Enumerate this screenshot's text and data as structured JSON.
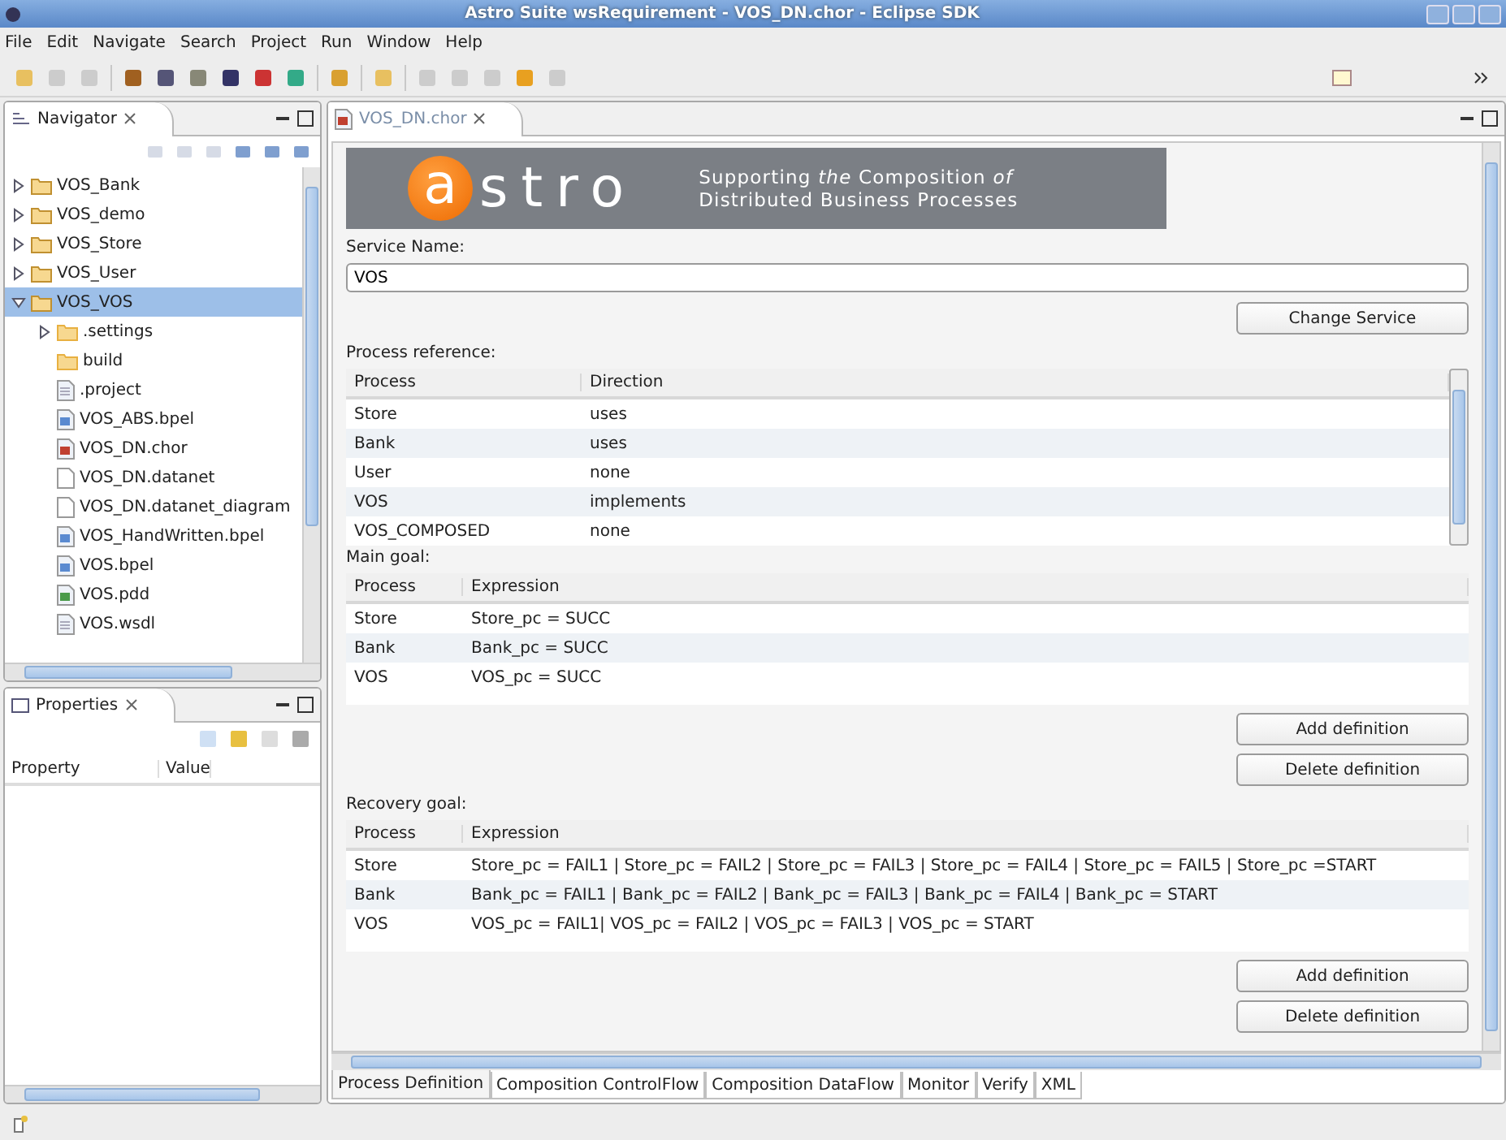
{
  "window": {
    "title": "Astro Suite wsRequirement - VOS_DN.chor - Eclipse SDK"
  },
  "menu": [
    {
      "label": "File"
    },
    {
      "label": "Edit"
    },
    {
      "label": "Navigate"
    },
    {
      "label": "Search"
    },
    {
      "label": "Project"
    },
    {
      "label": "Run"
    },
    {
      "label": "Window"
    },
    {
      "label": "Help"
    }
  ],
  "navigator": {
    "title": "Navigator",
    "items": [
      {
        "label": "VOS_Bank",
        "kind": "project",
        "expanded": false,
        "selected": false
      },
      {
        "label": "VOS_demo",
        "kind": "project",
        "expanded": false,
        "selected": false
      },
      {
        "label": "VOS_Store",
        "kind": "project",
        "expanded": false,
        "selected": false
      },
      {
        "label": "VOS_User",
        "kind": "project",
        "expanded": false,
        "selected": false
      },
      {
        "label": "VOS_VOS",
        "kind": "project",
        "expanded": true,
        "selected": true,
        "children": [
          {
            "label": ".settings",
            "kind": "folder-branch"
          },
          {
            "label": "build",
            "kind": "folder"
          },
          {
            "label": ".project",
            "kind": "file"
          },
          {
            "label": "VOS_ABS.bpel",
            "kind": "bpel"
          },
          {
            "label": "VOS_DN.chor",
            "kind": "chor"
          },
          {
            "label": "VOS_DN.datanet",
            "kind": "blank"
          },
          {
            "label": "VOS_DN.datanet_diagram",
            "kind": "blank"
          },
          {
            "label": "VOS_HandWritten.bpel",
            "kind": "bpel"
          },
          {
            "label": "VOS.bpel",
            "kind": "bpel"
          },
          {
            "label": "VOS.pdd",
            "kind": "pdd"
          },
          {
            "label": "VOS.wsdl",
            "kind": "file"
          }
        ]
      }
    ]
  },
  "properties": {
    "title": "Properties",
    "columns": [
      "Property",
      "Value"
    ]
  },
  "editor": {
    "tab": "VOS_DN.chor",
    "logo": {
      "highlight": "a",
      "rest": "stro",
      "tagline_1": "Supporting *the* Composition *of*",
      "tagline_2": "Distributed Business Processes"
    },
    "service_label": "Service Name:",
    "service_value": "VOS",
    "change_button": "Change Service",
    "process_reference": {
      "label": "Process reference:",
      "columns": [
        "Process",
        "Direction"
      ],
      "rows": [
        [
          "Store",
          "uses"
        ],
        [
          "Bank",
          "uses"
        ],
        [
          "User",
          "none"
        ],
        [
          "VOS",
          "implements"
        ],
        [
          "VOS_COMPOSED",
          "none"
        ]
      ]
    },
    "main_goal": {
      "label": "Main goal:",
      "columns": [
        "Process",
        "Expression"
      ],
      "rows": [
        [
          "Store",
          "Store_pc = SUCC"
        ],
        [
          "Bank",
          "Bank_pc = SUCC"
        ],
        [
          "VOS",
          "VOS_pc = SUCC"
        ]
      ],
      "buttons": [
        "Add definition",
        "Delete definition"
      ]
    },
    "recovery_goal": {
      "label": "Recovery goal:",
      "columns": [
        "Process",
        "Expression"
      ],
      "rows": [
        [
          "Store",
          "Store_pc = FAIL1 | Store_pc = FAIL2 | Store_pc = FAIL3 | Store_pc = FAIL4 | Store_pc = FAIL5 | Store_pc =START"
        ],
        [
          "Bank",
          "Bank_pc = FAIL1 | Bank_pc = FAIL2 | Bank_pc = FAIL3 | Bank_pc = FAIL4 | Bank_pc = START"
        ],
        [
          "VOS",
          "VOS_pc = FAIL1| VOS_pc = FAIL2 | VOS_pc = FAIL3 | VOS_pc = START"
        ]
      ],
      "buttons": [
        "Add definition",
        "Delete definition"
      ]
    },
    "pages": [
      {
        "label": "Process Definition",
        "selected": true
      },
      {
        "label": "Composition ControlFlow",
        "selected": false
      },
      {
        "label": "Composition DataFlow",
        "selected": false
      },
      {
        "label": "Monitor",
        "selected": false
      },
      {
        "label": "Verify",
        "selected": false
      },
      {
        "label": "XML",
        "selected": false
      }
    ]
  }
}
